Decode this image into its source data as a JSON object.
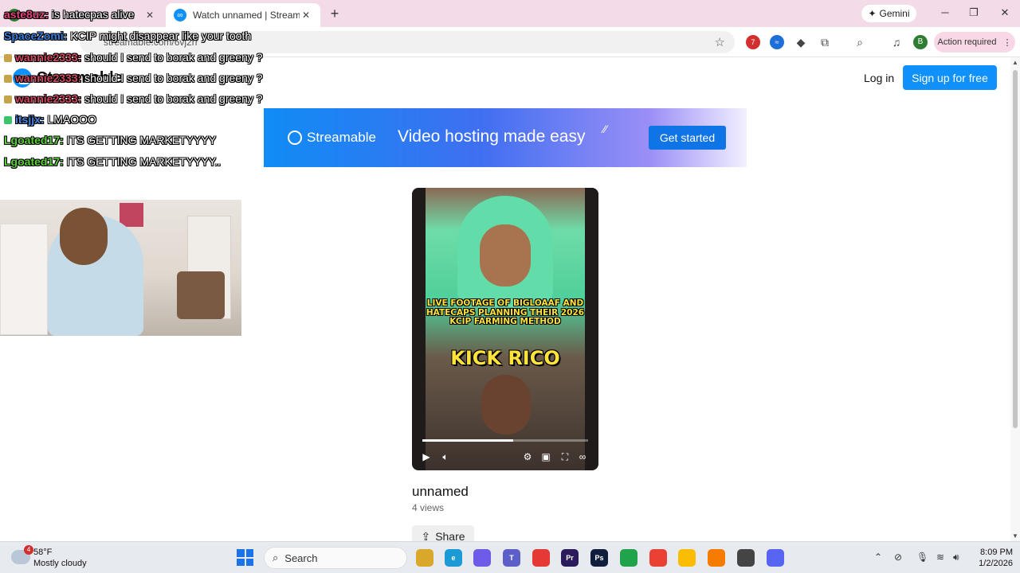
{
  "browser": {
    "tabs": [
      {
        "title": "",
        "active": false
      },
      {
        "title": "Watch unnamed | Streamable",
        "active": true
      }
    ],
    "tab_close": "✕",
    "new_tab": "+",
    "gemini_label": "Gemini",
    "url": "streamable.com/6vj2rr",
    "action_required": "Action required",
    "avatar_initial": "B",
    "ext_badge": "7"
  },
  "site": {
    "logo": "Streamable",
    "login": "Log in",
    "signup": "Sign up for free",
    "banner": {
      "logo": "Streamable",
      "tagline": "Video hosting made easy",
      "cta": "Get started"
    },
    "video": {
      "caption": "LIVE FOOTAGE OF BIGLOAAF AND HATECAPS PLANNING THEIR 2026 KCIP FARMING METHOD",
      "big_text": "KICK RICO",
      "progress": 0.55,
      "title": "unnamed",
      "views": "4 views",
      "share": "Share"
    }
  },
  "chat": [
    {
      "user": "aste8uz:",
      "msg": "is hatecpas alive",
      "color": "#e0457b"
    },
    {
      "user": "SpaceZomi:",
      "msg": "KCIP might disappear like your tooth",
      "color": "#3b7ee0"
    },
    {
      "user": "wannie2333:",
      "msg": "should I send to borak and greeny ?",
      "color": "#d2465f"
    },
    {
      "user": "wannie2333:",
      "msg": "should I send to borak and greeny ?",
      "color": "#d2465f"
    },
    {
      "user": "wannie2333:",
      "msg": "should I send to borak and greeny ?",
      "color": "#d2465f"
    },
    {
      "user": "itsjjx:",
      "msg": "LMAOOO",
      "color": "#4e86e4"
    },
    {
      "user": "Lgoated17:",
      "msg": "ITS GETTING MARKETYYYY",
      "color": "#5bd13a"
    },
    {
      "user": "Lgoated17:",
      "msg": "ITS GETTING MARKETYYYY..",
      "color": "#5bd13a"
    }
  ],
  "taskbar": {
    "temp": "58°F",
    "condition": "Mostly cloudy",
    "weather_badge": "4",
    "search": "Search",
    "time": "8:09 PM",
    "date": "1/2/2026",
    "apps": [
      {
        "name": "file-explorer-icon",
        "label": "",
        "color": "#d9a72a"
      },
      {
        "name": "edge-icon",
        "label": "e",
        "color": "#1c9ad6"
      },
      {
        "name": "copilot-icon",
        "label": "",
        "color": "#6c5ce7"
      },
      {
        "name": "teams-icon",
        "label": "T",
        "color": "#5b5fc7"
      },
      {
        "name": "app-red-icon",
        "label": "",
        "color": "#e53935"
      },
      {
        "name": "premiere-icon",
        "label": "Pr",
        "color": "#2b1a5c"
      },
      {
        "name": "photoshop-icon",
        "label": "Ps",
        "color": "#0f1e3d"
      },
      {
        "name": "green-app-icon",
        "label": "",
        "color": "#20a34a"
      },
      {
        "name": "chrome-icon",
        "label": "",
        "color": "#e94235"
      },
      {
        "name": "chrome-2-icon",
        "label": "",
        "color": "#fbbc04"
      },
      {
        "name": "vlc-icon",
        "label": "",
        "color": "#f57c00"
      },
      {
        "name": "obs-icon",
        "label": "",
        "color": "#444"
      },
      {
        "name": "discord-icon",
        "label": "",
        "color": "#5865f2"
      }
    ]
  }
}
